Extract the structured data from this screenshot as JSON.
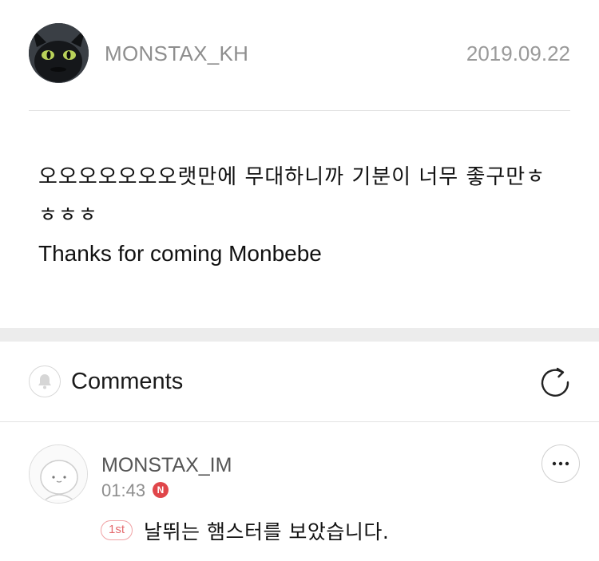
{
  "post": {
    "author": "MONSTAX_KH",
    "date": "2019.09.22",
    "body_line1": "오오오오오오오랫만에 무대하니까 기분이 너무 좋구만ㅎ",
    "body_line2": "ㅎㅎㅎ",
    "body_line3": "Thanks for coming Monbebe",
    "avatar_icon": "dragon-avatar-icon"
  },
  "comments": {
    "title": "Comments",
    "notify_icon": "bell-icon",
    "refresh_icon": "refresh-icon",
    "items": [
      {
        "author": "MONSTAX_IM",
        "time": "01:43",
        "new_badge": "N",
        "rank_badge": "1st",
        "text": "날뛰는 햄스터를 보았습니다.",
        "more_icon": "more-icon",
        "avatar_icon": "hamster-avatar-icon"
      }
    ]
  },
  "colors": {
    "accent_red": "#e0464a",
    "rank_border": "#f0a1a4",
    "muted_text": "#8e8e8e",
    "section_gap": "#ececec"
  }
}
